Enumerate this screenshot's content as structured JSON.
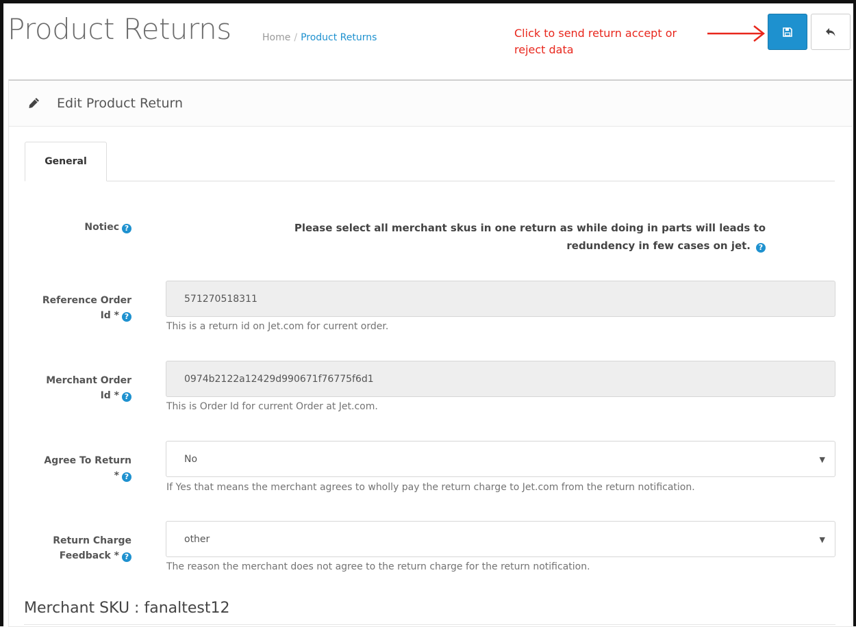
{
  "header": {
    "title": "Product Returns",
    "breadcrumb": {
      "home": "Home",
      "separator": "/",
      "current": "Product Returns"
    }
  },
  "annotation": {
    "line1": "Click to send return accept or",
    "line2": "reject data",
    "color": "#e8261c"
  },
  "toolbar": {
    "save_icon": "floppy-disk-icon",
    "back_icon": "reply-arrow-icon"
  },
  "panel": {
    "heading": "Edit Product Return",
    "heading_icon": "pencil-icon"
  },
  "tabs": [
    {
      "label": "General",
      "active": true
    }
  ],
  "form": {
    "notice": {
      "label": "Notiec",
      "text_line1": "Please select all merchant skus in one return as while doing in parts will leads to",
      "text_line2": "redundency in few cases on jet."
    },
    "reference_order": {
      "label_line1": "Reference Order",
      "label_line2": "Id *",
      "value": "571270518311",
      "hint": "This is a return id on Jet.com for current order."
    },
    "merchant_order": {
      "label_line1": "Merchant Order",
      "label_line2": "Id *",
      "value": "0974b2122a12429d990671f76775f6d1",
      "hint": "This is Order Id for current Order at Jet.com."
    },
    "agree_to_return": {
      "label_line1": "Agree To Return",
      "label_line2": "*",
      "value": "No",
      "hint": "If Yes that means the merchant agrees to wholly pay the return charge to Jet.com from the return notification."
    },
    "return_charge_feedback": {
      "label_line1": "Return Charge",
      "label_line2": "Feedback *",
      "value": "other",
      "hint": "The reason the merchant does not agree to the return charge for the return notification."
    }
  },
  "sku_section": {
    "heading": "Merchant SKU : fanaltest12"
  },
  "colors": {
    "primary": "#1e91cf",
    "annotation": "#e8261c"
  }
}
